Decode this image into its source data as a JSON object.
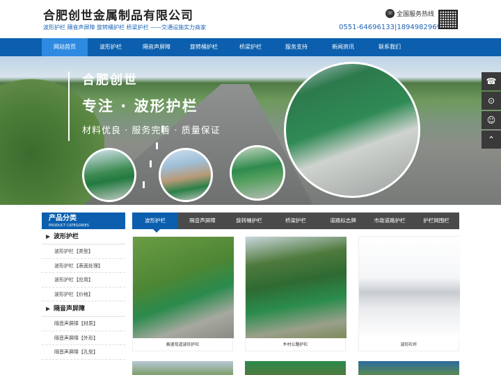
{
  "header": {
    "brand": "合肥创世金属制品有限公司",
    "slogan": "波形护栏 隔音声屏障 旋转桶护栏 桥梁护栏 ——交通设施实力商家",
    "hotline_label": "全国服务热线",
    "hotline_number": "0551-64696133|18949829695"
  },
  "nav": {
    "items": [
      "网站首页",
      "波形护栏",
      "隔音声屏障",
      "旋转桶护栏",
      "桥梁护栏",
      "服务支持",
      "新闻资讯",
      "联系我们"
    ],
    "active": 0
  },
  "banner": {
    "line1": "合肥创世",
    "line2": "专注 · 波形护栏",
    "line3": "材料优良 · 服务完善 · 质量保证"
  },
  "sidebar_buttons": [
    "phone-icon",
    "location-icon",
    "user-icon",
    "top-icon"
  ],
  "categories": {
    "title": "产品分类",
    "subtitle": "PRODUCT CATEGORIES",
    "groups": [
      {
        "name": "波形护栏",
        "items": [
          "波形护栏【类型】",
          "波形护栏【表面处理】",
          "波形护栏【应用】",
          "波形护栏【价格】"
        ]
      },
      {
        "name": "隔音声屏障",
        "items": [
          "隔音声屏障【材质】",
          "隔音声屏障【外形】",
          "隔音声屏障【孔型】"
        ]
      }
    ]
  },
  "product_tabs": [
    "波形护栏",
    "隔音声屏障",
    "旋转桶护栏",
    "桥梁护栏",
    "道路标志牌",
    "市政道路护栏",
    "护栏网围栏"
  ],
  "products": [
    {
      "caption": "高速弯道波形护栏"
    },
    {
      "caption": "乡村公路护栏"
    },
    {
      "caption": "波形栏杆"
    }
  ],
  "colors": {
    "primary": "#0b5fae",
    "tabbar": "#4a4a4a"
  }
}
